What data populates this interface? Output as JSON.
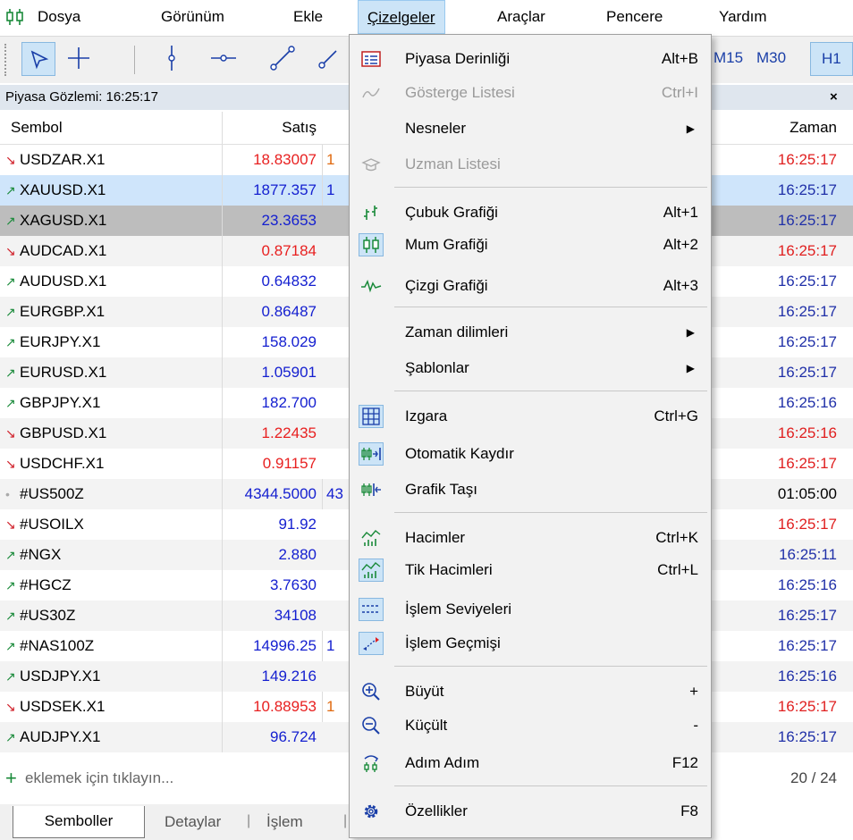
{
  "menubar": {
    "items": [
      "Dosya",
      "Görünüm",
      "Ekle",
      "Çizelgeler",
      "Araçlar",
      "Pencere",
      "Yardım"
    ]
  },
  "toolbar": {
    "timeframes": [
      "M15",
      "M30",
      "H1"
    ]
  },
  "panel": {
    "title": "Piyasa Gözlemi: 16:25:17",
    "close": "×",
    "headers": {
      "symbol": "Sembol",
      "bid": "Satış",
      "time": "Zaman"
    },
    "rows": [
      {
        "dir": "down",
        "symbol": "USDZAR.X1",
        "bid": "18.83007",
        "ask": "1",
        "time": "16:25:17",
        "bidColor": "red",
        "timeColor": "red"
      },
      {
        "dir": "up",
        "symbol": "XAUUSD.X1",
        "bid": "1877.357",
        "ask": "1",
        "time": "16:25:17",
        "bidColor": "blue",
        "timeColor": "blue"
      },
      {
        "dir": "up",
        "symbol": "XAGUSD.X1",
        "bid": "23.3653",
        "ask": "",
        "time": "16:25:17",
        "bidColor": "blue",
        "timeColor": "blue"
      },
      {
        "dir": "down",
        "symbol": "AUDCAD.X1",
        "bid": "0.87184",
        "ask": "",
        "time": "16:25:17",
        "bidColor": "red",
        "timeColor": "red"
      },
      {
        "dir": "up",
        "symbol": "AUDUSD.X1",
        "bid": "0.64832",
        "ask": "",
        "time": "16:25:17",
        "bidColor": "blue",
        "timeColor": "blue"
      },
      {
        "dir": "up",
        "symbol": "EURGBP.X1",
        "bid": "0.86487",
        "ask": "",
        "time": "16:25:17",
        "bidColor": "blue",
        "timeColor": "blue"
      },
      {
        "dir": "up",
        "symbol": "EURJPY.X1",
        "bid": "158.029",
        "ask": "",
        "time": "16:25:17",
        "bidColor": "blue",
        "timeColor": "blue"
      },
      {
        "dir": "up",
        "symbol": "EURUSD.X1",
        "bid": "1.05901",
        "ask": "",
        "time": "16:25:17",
        "bidColor": "blue",
        "timeColor": "blue"
      },
      {
        "dir": "up",
        "symbol": "GBPJPY.X1",
        "bid": "182.700",
        "ask": "",
        "time": "16:25:16",
        "bidColor": "blue",
        "timeColor": "blue"
      },
      {
        "dir": "down",
        "symbol": "GBPUSD.X1",
        "bid": "1.22435",
        "ask": "",
        "time": "16:25:16",
        "bidColor": "red",
        "timeColor": "red"
      },
      {
        "dir": "down",
        "symbol": "USDCHF.X1",
        "bid": "0.91157",
        "ask": "",
        "time": "16:25:17",
        "bidColor": "red",
        "timeColor": "red"
      },
      {
        "dir": "none",
        "symbol": "#US500Z",
        "bid": "4344.5000",
        "ask": "43",
        "time": "01:05:00",
        "bidColor": "blue",
        "timeColor": "black"
      },
      {
        "dir": "down",
        "symbol": "#USOILX",
        "bid": "91.92",
        "ask": "",
        "time": "16:25:17",
        "bidColor": "blue",
        "timeColor": "red"
      },
      {
        "dir": "up",
        "symbol": "#NGX",
        "bid": "2.880",
        "ask": "",
        "time": "16:25:11",
        "bidColor": "blue",
        "timeColor": "blue"
      },
      {
        "dir": "up",
        "symbol": "#HGCZ",
        "bid": "3.7630",
        "ask": "",
        "time": "16:25:16",
        "bidColor": "blue",
        "timeColor": "blue"
      },
      {
        "dir": "up",
        "symbol": "#US30Z",
        "bid": "34108",
        "ask": "",
        "time": "16:25:17",
        "bidColor": "blue",
        "timeColor": "blue"
      },
      {
        "dir": "up",
        "symbol": "#NAS100Z",
        "bid": "14996.25",
        "ask": "1",
        "time": "16:25:17",
        "bidColor": "blue",
        "timeColor": "blue"
      },
      {
        "dir": "up",
        "symbol": "USDJPY.X1",
        "bid": "149.216",
        "ask": "",
        "time": "16:25:16",
        "bidColor": "blue",
        "timeColor": "blue"
      },
      {
        "dir": "down",
        "symbol": "USDSEK.X1",
        "bid": "10.88953",
        "ask": "1",
        "time": "16:25:17",
        "bidColor": "red",
        "timeColor": "red"
      },
      {
        "dir": "up",
        "symbol": "AUDJPY.X1",
        "bid": "96.724",
        "ask": "",
        "time": "16:25:17",
        "bidColor": "blue",
        "timeColor": "blue"
      }
    ],
    "add_label": "eklemek için tıklayın...",
    "count": "20 / 24"
  },
  "tabs": [
    "Semboller",
    "Detaylar",
    "İşlem"
  ],
  "dropdown": {
    "items": [
      {
        "label": "Piyasa Derinliği",
        "shortcut": "Alt+B",
        "icon": "market-depth-icon"
      },
      {
        "label": "Gösterge Listesi",
        "shortcut": "Ctrl+I",
        "icon": "indicator-list-icon",
        "disabled": true
      },
      {
        "label": "Nesneler",
        "submenu": true
      },
      {
        "label": "Uzman Listesi",
        "icon": "expert-list-icon",
        "disabled": true
      },
      {
        "label": "Çubuk Grafiği",
        "shortcut": "Alt+1",
        "icon": "bar-chart-icon"
      },
      {
        "label": "Mum Grafiği",
        "shortcut": "Alt+2",
        "icon": "candlestick-icon",
        "boxed": true
      },
      {
        "label": "Çizgi Grafiği",
        "shortcut": "Alt+3",
        "icon": "line-chart-icon"
      },
      {
        "label": "Zaman dilimleri",
        "submenu": true
      },
      {
        "label": "Şablonlar",
        "submenu": true
      },
      {
        "label": "Izgara",
        "shortcut": "Ctrl+G",
        "icon": "grid-icon",
        "boxed": true
      },
      {
        "label": "Otomatik Kaydır",
        "icon": "auto-scroll-icon",
        "boxed": true
      },
      {
        "label": "Grafik Taşı",
        "icon": "chart-shift-icon"
      },
      {
        "label": "Hacimler",
        "shortcut": "Ctrl+K",
        "icon": "volumes-icon"
      },
      {
        "label": "Tik Hacimleri",
        "shortcut": "Ctrl+L",
        "icon": "tick-volumes-icon",
        "boxed": true
      },
      {
        "label": "İşlem Seviyeleri",
        "icon": "trade-levels-icon",
        "boxed": true
      },
      {
        "label": "İşlem Geçmişi",
        "icon": "trade-history-icon",
        "boxed": true
      },
      {
        "label": "Büyüt",
        "shortcut": "+",
        "icon": "zoom-in-icon"
      },
      {
        "label": "Küçült",
        "shortcut": "-",
        "icon": "zoom-out-icon"
      },
      {
        "label": "Adım Adım",
        "shortcut": "F12",
        "icon": "step-by-step-icon"
      },
      {
        "label": "Özellikler",
        "shortcut": "F8",
        "icon": "gear-icon"
      }
    ]
  }
}
